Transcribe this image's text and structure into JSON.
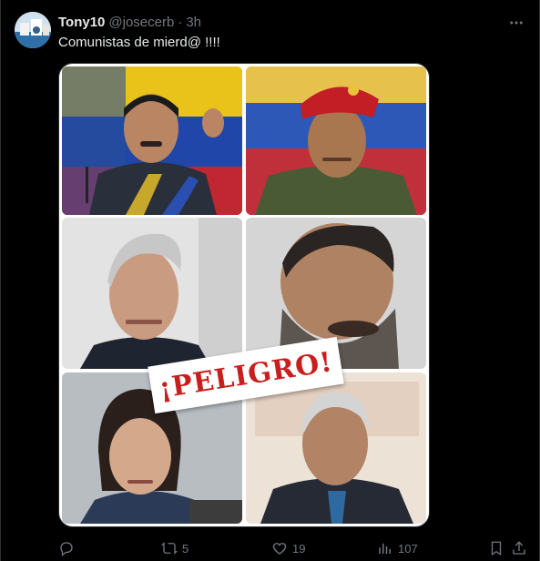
{
  "tweet": {
    "display_name": "Tony10",
    "handle": "@josecerb",
    "separator": "·",
    "time": "3h",
    "text": "Comunistas de mierd@ !!!!",
    "more_icon": "more-horizontal-icon"
  },
  "media": {
    "banner_text": "¡PELIGRO!",
    "banner_color": "#c81e1e"
  },
  "actions": {
    "reply": {
      "icon": "reply-icon",
      "count": ""
    },
    "retweet": {
      "icon": "retweet-icon",
      "count": "5"
    },
    "like": {
      "icon": "heart-icon",
      "count": "19"
    },
    "views": {
      "icon": "views-icon",
      "count": "107"
    },
    "bookmark": {
      "icon": "bookmark-icon"
    },
    "share": {
      "icon": "share-icon"
    }
  },
  "colors": {
    "background": "#000000",
    "text_primary": "#e7e9ea",
    "text_secondary": "#71767b",
    "border": "#2f3336"
  }
}
